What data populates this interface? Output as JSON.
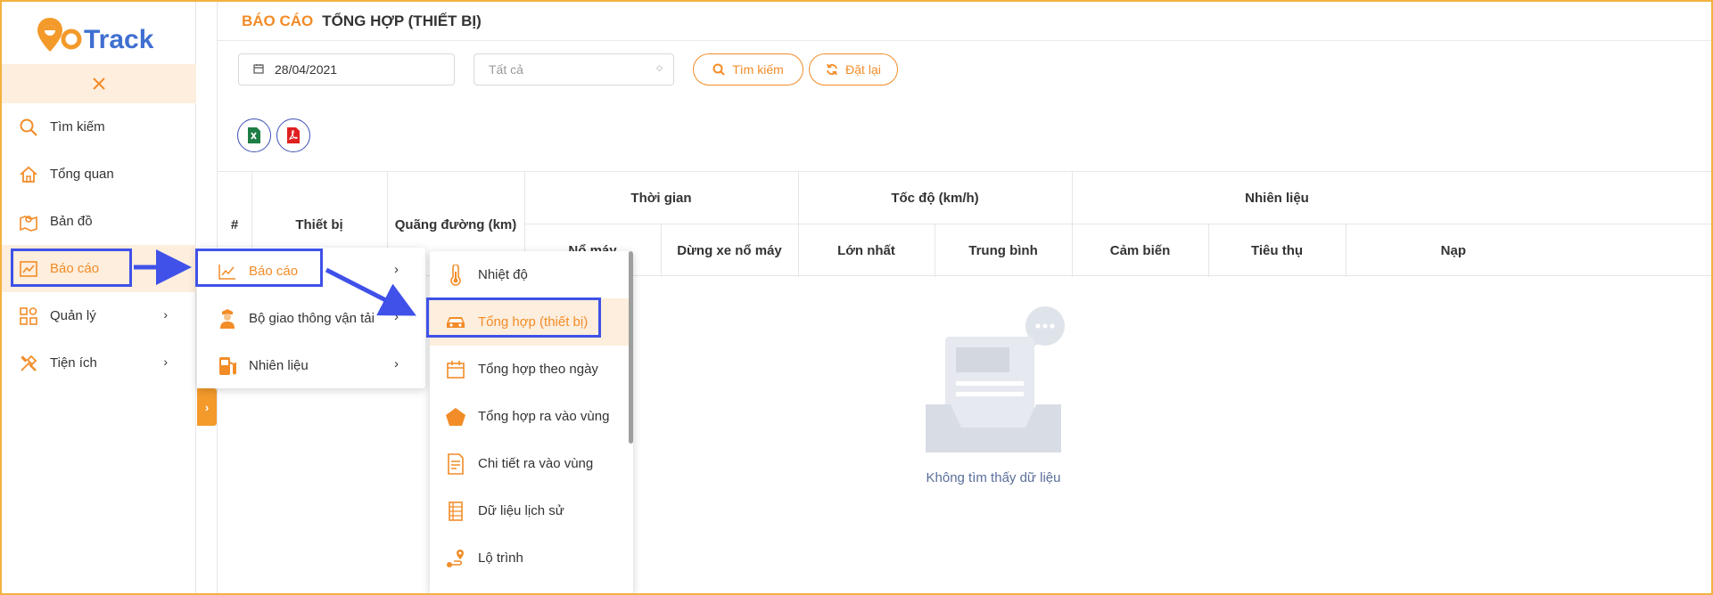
{
  "app": {
    "logo_text": "GoTrack"
  },
  "sidebar": {
    "items": [
      {
        "label": "Tìm kiếm",
        "icon": "search-icon"
      },
      {
        "label": "Tổng quan",
        "icon": "home-icon"
      },
      {
        "label": "Bản đồ",
        "icon": "map-icon"
      },
      {
        "label": "Báo cáo",
        "icon": "chart-icon",
        "active": true
      },
      {
        "label": "Quản lý",
        "icon": "grid-icon"
      },
      {
        "label": "Tiện ích",
        "icon": "tools-icon"
      }
    ]
  },
  "header": {
    "section": "BÁO CÁO",
    "title": "TỔNG HỢP (THIẾT BỊ)"
  },
  "filters": {
    "date_value": "28/04/2021",
    "select_value": "Tất cả",
    "search_label": "Tìm kiếm",
    "reset_label": "Đặt lại"
  },
  "table": {
    "col_index": "#",
    "col_device": "Thiết bị",
    "col_distance": "Quãng đường (km)",
    "group_time": "Thời gian",
    "group_speed": "Tốc độ (km/h)",
    "group_fuel": "Nhiên liệu",
    "sub_engine_on": "Nổ máy",
    "sub_idle": "Dừng xe nổ máy",
    "sub_max": "Lớn nhất",
    "sub_avg": "Trung bình",
    "sub_sensor": "Cảm biến",
    "sub_consume": "Tiêu thụ",
    "sub_refill": "Nạp"
  },
  "empty": {
    "text": "Không tìm thấy dữ liệu"
  },
  "submenu_level1": {
    "items": [
      {
        "label": "Báo cáo",
        "icon": "line-chart-icon",
        "active": true
      },
      {
        "label": "Bộ giao thông vận tải",
        "icon": "officer-icon"
      },
      {
        "label": "Nhiên liệu",
        "icon": "fuel-pump-icon"
      }
    ]
  },
  "submenu_level2": {
    "items": [
      {
        "label": "Nhiệt độ",
        "icon": "thermometer-icon"
      },
      {
        "label": "Tổng hợp (thiết bị)",
        "icon": "car-icon",
        "active": true
      },
      {
        "label": "Tổng hợp theo ngày",
        "icon": "calendar-icon"
      },
      {
        "label": "Tổng hợp ra vào vùng",
        "icon": "pentagon-icon"
      },
      {
        "label": "Chi tiết ra vào vùng",
        "icon": "document-icon"
      },
      {
        "label": "Dữ liệu lịch sử",
        "icon": "history-icon"
      },
      {
        "label": "Lộ trình",
        "icon": "route-icon"
      }
    ]
  },
  "colors": {
    "accent": "#f28c28",
    "accent_light": "#fdeedd",
    "highlight": "#3f51e8"
  }
}
